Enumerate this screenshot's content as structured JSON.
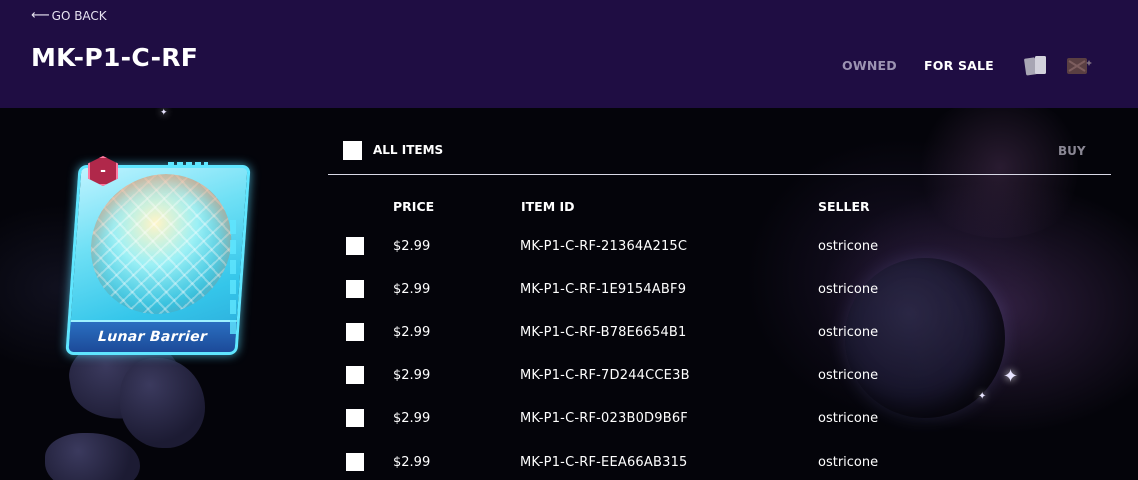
{
  "header": {
    "back_label": "GO BACK",
    "title": "MK-P1-C-RF",
    "tabs": [
      {
        "label": "OWNED",
        "active": false
      },
      {
        "label": "FOR SALE",
        "active": true
      }
    ],
    "view_icons": [
      "cards-stack-icon",
      "pack-icon"
    ]
  },
  "card": {
    "name": "Lunar Barrier",
    "badge": "-"
  },
  "listing": {
    "all_items_label": "ALL ITEMS",
    "buy_label": "BUY",
    "columns": {
      "price": "PRICE",
      "item_id": "ITEM ID",
      "seller": "SELLER"
    },
    "rows": [
      {
        "price": "$2.99",
        "item_id": "MK-P1-C-RF-21364A215C",
        "seller": "ostricone"
      },
      {
        "price": "$2.99",
        "item_id": "MK-P1-C-RF-1E9154ABF9",
        "seller": "ostricone"
      },
      {
        "price": "$2.99",
        "item_id": "MK-P1-C-RF-B78E6654B1",
        "seller": "ostricone"
      },
      {
        "price": "$2.99",
        "item_id": "MK-P1-C-RF-7D244CCE3B",
        "seller": "ostricone"
      },
      {
        "price": "$2.99",
        "item_id": "MK-P1-C-RF-023B0D9B6F",
        "seller": "ostricone"
      },
      {
        "price": "$2.99",
        "item_id": "MK-P1-C-RF-EEA66AB315",
        "seller": "ostricone"
      }
    ]
  },
  "colors": {
    "header_bg": "#1f0d43",
    "page_bg": "#04040a",
    "card_glow": "#5fe6ff",
    "muted_text": "#8a8794"
  }
}
